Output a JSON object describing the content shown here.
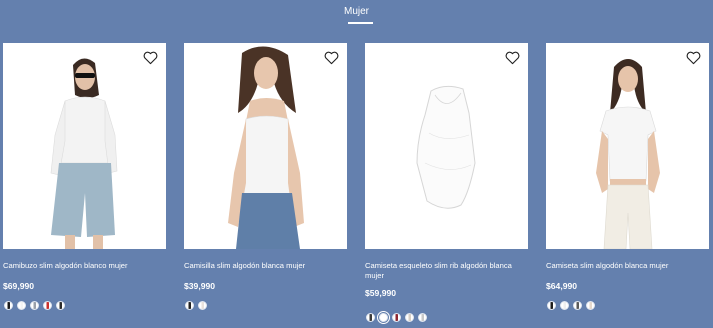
{
  "tabs": {
    "active_label": "Mujer"
  },
  "products": [
    {
      "title": "Camibuzo slim algodón blanco mujer",
      "price": "$69,990",
      "swatches": [
        {
          "color": "#1c1c1c",
          "icon": "model-black-top"
        },
        {
          "color": "#f4f4f4",
          "icon": "model-white-top"
        },
        {
          "color": "#9aa0aa",
          "icon": "model-grey-top"
        },
        {
          "color": "#c9302c",
          "icon": "model-red-top"
        },
        {
          "color": "#2b2b2b",
          "icon": "model-dark-top"
        }
      ]
    },
    {
      "title": "Camisilla slim algodón blanca mujer",
      "price": "$39,990",
      "swatches": [
        {
          "color": "#222222",
          "icon": "model-black-top"
        },
        {
          "color": "#e9e2dc",
          "icon": "model-light-top"
        }
      ]
    },
    {
      "title": "Camiseta esqueleto slim rib algodón blanca mujer",
      "price": "$59,990",
      "swatches": [
        {
          "color": "#3a3a3a",
          "icon": "model-dark-top"
        },
        {
          "color": "#ffffff",
          "icon": "model-white-top"
        },
        {
          "color": "#8e2630",
          "icon": "model-red-top"
        },
        {
          "color": "#d8cfc4",
          "icon": "model-beige-top"
        },
        {
          "color": "#c8c8c8",
          "icon": "model-grey-top"
        }
      ]
    },
    {
      "title": "Camiseta slim algodón blanca mujer",
      "price": "$64,990",
      "swatches": [
        {
          "color": "#1e1e1e",
          "icon": "model-black-top"
        },
        {
          "color": "#efefef",
          "icon": "model-white-top"
        },
        {
          "color": "#5a5a5a",
          "icon": "model-dark-top"
        },
        {
          "color": "#e4d8cc",
          "icon": "model-beige-top"
        }
      ]
    }
  ],
  "colors": {
    "background": "#6480ae",
    "text": "#ffffff",
    "photo_bg": "#ffffff",
    "heart_stroke": "#222222"
  },
  "icons": {
    "wishlist": "heart-outline-icon"
  }
}
